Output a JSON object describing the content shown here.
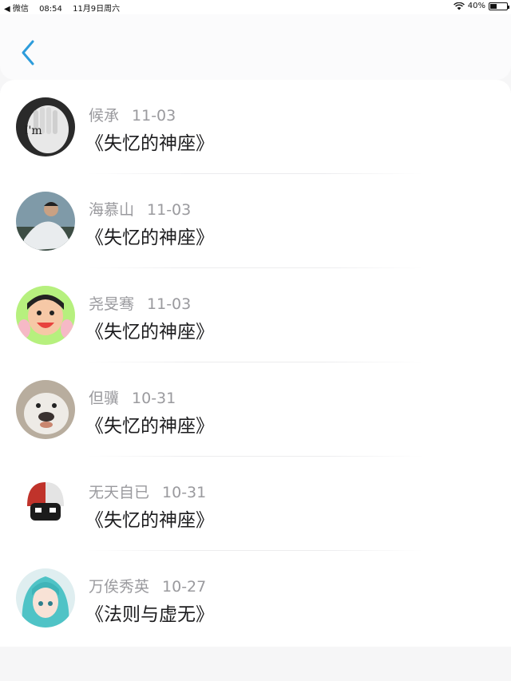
{
  "status_bar": {
    "back_app": "◀ 微信",
    "time": "08:54",
    "date": "11月9日周六",
    "battery": "40%",
    "battery_level": 0.4
  },
  "header": {
    "back_icon": "chevron-left-icon",
    "accent_color": "#2d9cdb"
  },
  "items": [
    {
      "user": "候承",
      "date": "11-03",
      "title": "《失忆的神座》"
    },
    {
      "user": "海慕山",
      "date": "11-03",
      "title": "《失忆的神座》"
    },
    {
      "user": "尧旻骞",
      "date": "11-03",
      "title": "《失忆的神座》"
    },
    {
      "user": "但骥",
      "date": "10-31",
      "title": "《失忆的神座》"
    },
    {
      "user": "无天自已",
      "date": "10-31",
      "title": "《失忆的神座》"
    },
    {
      "user": "万俟秀英",
      "date": "10-27",
      "title": "《法则与虚无》"
    }
  ]
}
